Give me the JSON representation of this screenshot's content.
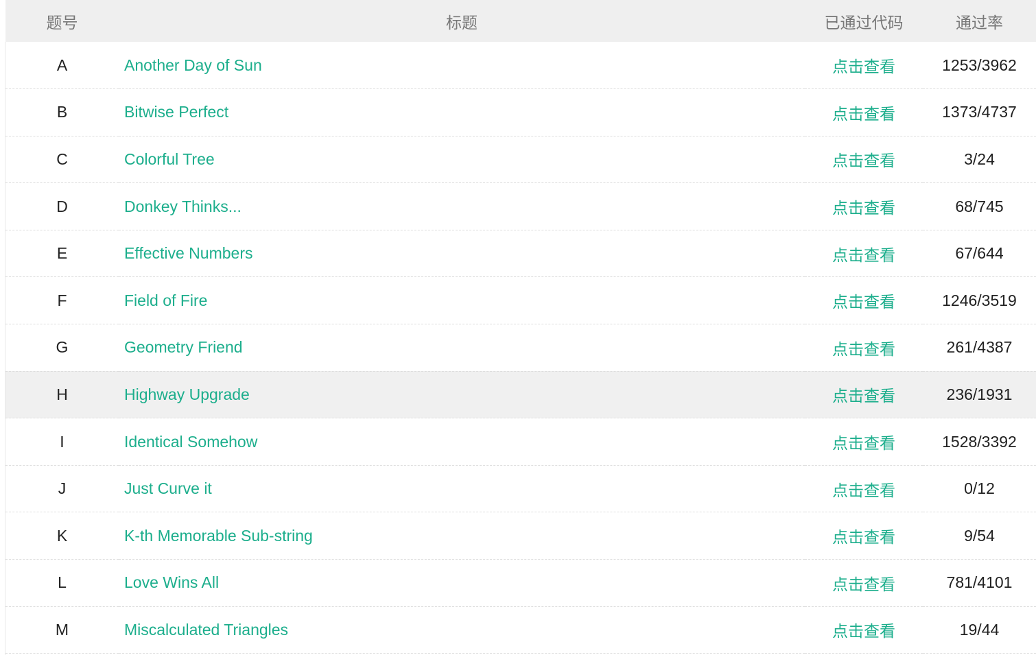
{
  "header": {
    "id": "题号",
    "title": "标题",
    "code": "已通过代码",
    "rate": "通过率"
  },
  "accent_color": "#1cae8c",
  "hover_row": "H",
  "rows": [
    {
      "id": "A",
      "title": "Another Day of Sun",
      "code": "点击查看",
      "rate": "1253/3962"
    },
    {
      "id": "B",
      "title": "Bitwise Perfect",
      "code": "点击查看",
      "rate": "1373/4737"
    },
    {
      "id": "C",
      "title": "Colorful Tree",
      "code": "点击查看",
      "rate": "3/24"
    },
    {
      "id": "D",
      "title": "Donkey Thinks...",
      "code": "点击查看",
      "rate": "68/745"
    },
    {
      "id": "E",
      "title": "Effective Numbers",
      "code": "点击查看",
      "rate": "67/644"
    },
    {
      "id": "F",
      "title": "Field of Fire",
      "code": "点击查看",
      "rate": "1246/3519"
    },
    {
      "id": "G",
      "title": "Geometry Friend",
      "code": "点击查看",
      "rate": "261/4387"
    },
    {
      "id": "H",
      "title": "Highway Upgrade",
      "code": "点击查看",
      "rate": "236/1931"
    },
    {
      "id": "I",
      "title": "Identical Somehow",
      "code": "点击查看",
      "rate": "1528/3392"
    },
    {
      "id": "J",
      "title": "Just Curve it",
      "code": "点击查看",
      "rate": "0/12"
    },
    {
      "id": "K",
      "title": "K-th Memorable Sub-string",
      "code": "点击查看",
      "rate": "9/54"
    },
    {
      "id": "L",
      "title": "Love Wins All",
      "code": "点击查看",
      "rate": "781/4101"
    },
    {
      "id": "M",
      "title": "Miscalculated Triangles",
      "code": "点击查看",
      "rate": "19/44"
    }
  ]
}
